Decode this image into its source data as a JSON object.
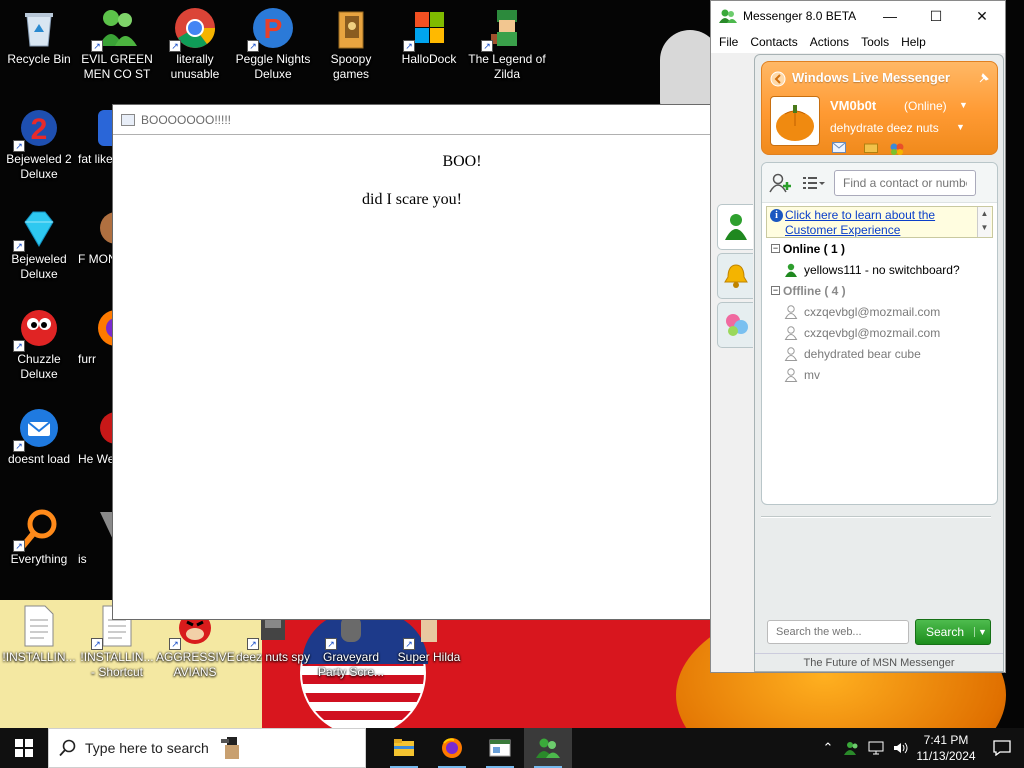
{
  "desktop": {
    "icons": [
      {
        "label": "Recycle Bin",
        "icon": "recycle-bin-icon"
      },
      {
        "label": "EVIL GREEN MEN CO ST",
        "icon": "green-men-icon"
      },
      {
        "label": "literally unusable",
        "icon": "chrome-icon"
      },
      {
        "label": "Peggle Nights Deluxe",
        "icon": "peggle-icon"
      },
      {
        "label": "Spoopy games",
        "icon": "folder-icon"
      },
      {
        "label": "HalloDock",
        "icon": "windows-logo-icon"
      },
      {
        "label": "The Legend of Zilda",
        "icon": "zilda-icon"
      },
      {
        "label": "Bejeweled 2 Deluxe",
        "icon": "bejeweled2-icon"
      },
      {
        "label": "fat like",
        "icon": "app-icon"
      },
      {
        "label": "Bejeweled Deluxe",
        "icon": "diamond-icon"
      },
      {
        "label": "F MON",
        "icon": "app-icon"
      },
      {
        "label": "Chuzzle Deluxe",
        "icon": "chuzzle-icon"
      },
      {
        "label": "furr",
        "icon": "firefox-icon"
      },
      {
        "label": "doesnt load",
        "icon": "thunderbird-icon"
      },
      {
        "label": "He We",
        "icon": "app-icon"
      },
      {
        "label": "Everything",
        "icon": "magnifier-icon"
      },
      {
        "label": "is",
        "icon": "app-icon"
      },
      {
        "label": "!INSTALLIN...",
        "icon": "document-icon"
      },
      {
        "label": "!INSTALLIN... - Shortcut",
        "icon": "document-icon"
      },
      {
        "label": "AGGRESSIVE AVIANS",
        "icon": "angry-bird-icon"
      },
      {
        "label": "deez nuts spy",
        "icon": "app-icon"
      },
      {
        "label": "Graveyard Party Scre...",
        "icon": "app-icon"
      },
      {
        "label": "Super Hilda",
        "icon": "app-icon"
      }
    ]
  },
  "boo_window": {
    "title": "BOOOOOOO!!!!!",
    "line1": "BOO!",
    "line2": "did I scare you!"
  },
  "messenger": {
    "title": "Messenger 8.0 BETA",
    "menu": [
      "File",
      "Contacts",
      "Actions",
      "Tools",
      "Help"
    ],
    "brand": "Windows Live Messenger",
    "username": "VM0b0t",
    "status": "(Online)",
    "personal_message": "dehydrate deez nuts",
    "contact_search_placeholder": "Find a contact or number",
    "info_link": "Click here to learn about the Customer Experience",
    "groups": [
      {
        "label": "Online ( 1 )",
        "contacts": [
          "yellows111 - no switchboard?"
        ]
      },
      {
        "label": "Offline ( 4 )",
        "contacts": [
          "cxzqevbgl@mozmail.com",
          "cxzqevbgl@mozmail.com",
          "dehydrated bear cube",
          "mv"
        ]
      }
    ],
    "web_search_placeholder": "Search the web...",
    "search_button": "Search",
    "footer": "The Future of MSN Messenger",
    "colors": {
      "header_orange": "#ff9a33",
      "search_green": "#2a9e2a",
      "link_blue": "#0b3fc9"
    }
  },
  "taskbar": {
    "search_placeholder": "Type here to search",
    "time": "7:41 PM",
    "date": "11/13/2024",
    "apps": [
      "file-explorer-icon",
      "firefox-icon",
      "window-app-icon",
      "messenger-icon"
    ]
  }
}
